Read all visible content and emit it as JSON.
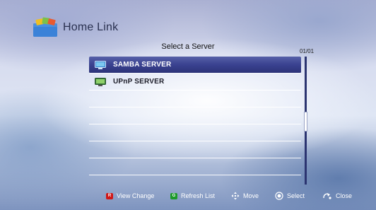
{
  "app": {
    "title": "Home Link",
    "icon": "home-link-folder-icon"
  },
  "panel": {
    "title": "Select a Server",
    "page_count": "01/01"
  },
  "servers": [
    {
      "label": "SAMBA SERVER",
      "icon": "network-server-icon",
      "selected": true
    },
    {
      "label": "UPnP SERVER",
      "icon": "media-server-icon",
      "selected": false
    }
  ],
  "empty_rows": 5,
  "footer": {
    "view_change": {
      "key": "R",
      "key_color": "#d01818",
      "label": "View Change"
    },
    "refresh_list": {
      "key": "G",
      "key_color": "#1d9a2a",
      "label": "Refresh List"
    },
    "move": {
      "icon": "directional-pad-icon",
      "label": "Move"
    },
    "select": {
      "icon": "enter-button-icon",
      "label": "Select"
    },
    "close": {
      "icon": "return-arrow-icon",
      "label": "Close"
    }
  },
  "colors": {
    "selection": "#3a4290",
    "scrollbar": "#2b3470",
    "title_text": "#2a3150"
  }
}
